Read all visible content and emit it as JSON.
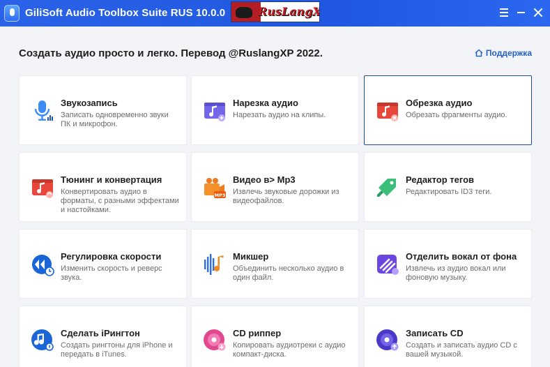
{
  "window": {
    "title": "GiliSoft Audio Toolbox Suite RUS 10.0.0",
    "banner_text": "RusLangXP"
  },
  "header": {
    "headline": "Создать аудио просто и легко. Перевод @RuslangXP 2022.",
    "support_label": "Поддержка"
  },
  "tools": [
    {
      "title": "Звукозапись",
      "desc": "Записать одновременно звуки ПК и микрофон.",
      "icon": "microphone-icon"
    },
    {
      "title": "Нарезка аудио",
      "desc": "Нарезать аудио на клипы.",
      "icon": "audio-cut-icon"
    },
    {
      "title": "Обрезка аудио",
      "desc": "Обрезать фрагменты аудио.",
      "icon": "audio-trim-icon",
      "selected": true
    },
    {
      "title": "Тюнинг и конвертация",
      "desc": "Конвертировать аудио в форматы, с разными эффектами и настойками.",
      "icon": "audio-convert-icon"
    },
    {
      "title": "Видео в> Mp3",
      "desc": "Извлечь звуковые дорожки из видеофайлов.",
      "icon": "video-to-mp3-icon"
    },
    {
      "title": "Редактор тегов",
      "desc": "Редактировать ID3 теги.",
      "icon": "tag-editor-icon"
    },
    {
      "title": "Регулировка скорости",
      "desc": "Изменить скорость и реверс звука.",
      "icon": "speed-icon"
    },
    {
      "title": "Микшер",
      "desc": "Объединить несколько аудио в один файл.",
      "icon": "mixer-icon"
    },
    {
      "title": "Отделить вокал от фона",
      "desc": "Извлечь из аудио вокал или фоновую музыку.",
      "icon": "vocal-remover-icon"
    },
    {
      "title": "Сделать iРингтон",
      "desc": "Создать рингтоны для iPhone и передать в iTunes.",
      "icon": "ringtone-icon"
    },
    {
      "title": "CD риппер",
      "desc": "Копировать аудиотреки с аудио компакт-диска.",
      "icon": "cd-ripper-icon"
    },
    {
      "title": "Записать CD",
      "desc": "Создать и записать аудио CD с вашей музыкой.",
      "icon": "cd-burner-icon"
    }
  ],
  "colors": {
    "titlebar": "#2160e6",
    "accent_blue": "#2462c9",
    "selected_border": "#1b4a97"
  }
}
